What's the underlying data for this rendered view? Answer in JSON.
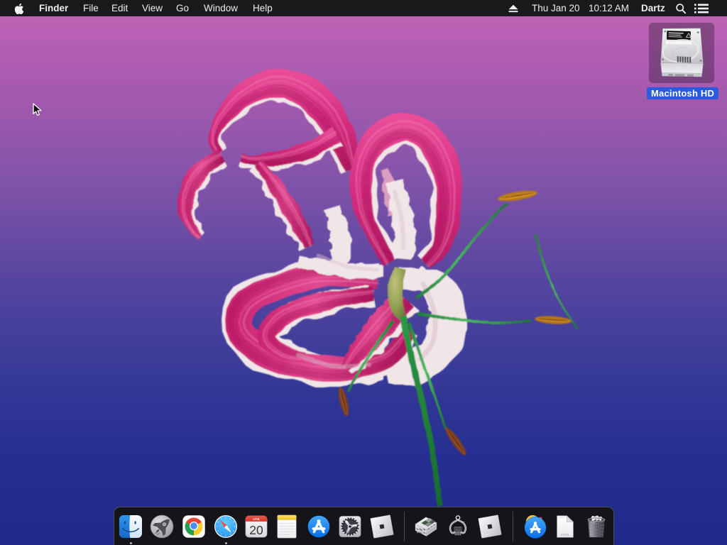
{
  "menubar": {
    "items": [
      "Finder",
      "File",
      "Edit",
      "View",
      "Go",
      "Window",
      "Help"
    ],
    "status": {
      "date": "Thu Jan 20",
      "time": "10:12 AM",
      "user": "Dartz"
    }
  },
  "desktop": {
    "volume_label": "Macintosh HD"
  },
  "dock": {
    "items": [
      "Finder",
      "Launchpad",
      "Chrome",
      "Safari",
      "Calendar",
      "Notes",
      "App Store",
      "System Preferences",
      "Roblox",
      "Disk Image",
      "Chip Extractor Tool",
      "Roblox Studio",
      "Applications",
      "HTML Document",
      "Trash"
    ],
    "calendar": {
      "month": "JAN",
      "day": "20"
    },
    "html_label": "HTML",
    "running_indicators": [
      "Finder",
      "Safari"
    ]
  },
  "colors": {
    "selection_label_blue": "#2a5ade",
    "menubar_background": "#1a191c",
    "dock_background": "#151419",
    "wallpaper_top": "#c066b5",
    "wallpaper_bottom": "#1f298c",
    "flower_pink": "#d62d80",
    "stem_green": "#2a9a46"
  }
}
